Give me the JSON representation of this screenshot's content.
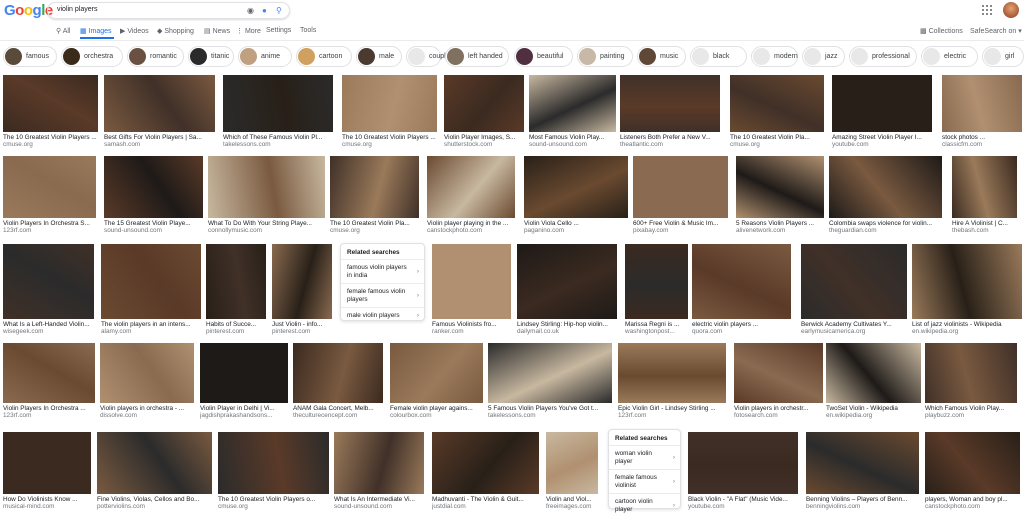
{
  "search": {
    "query": "violin players"
  },
  "logo": {
    "text": "Google",
    "colors": [
      "#4285f4",
      "#ea4335",
      "#fbbc05",
      "#4285f4",
      "#34a853",
      "#ea4335"
    ]
  },
  "tabs": [
    {
      "label": "All",
      "icon": "search-icon"
    },
    {
      "label": "Images",
      "icon": "image-icon",
      "active": true
    },
    {
      "label": "Videos",
      "icon": "video-icon"
    },
    {
      "label": "Shopping",
      "icon": "tag-icon"
    },
    {
      "label": "News",
      "icon": "news-icon"
    },
    {
      "label": "More",
      "icon": "more-icon"
    },
    {
      "label": "Settings"
    },
    {
      "label": "Tools"
    }
  ],
  "right_tools": {
    "collections": "Collections",
    "safesearch": "SafeSearch on"
  },
  "chips": [
    "famous",
    "orchestra",
    "romantic",
    "titanic",
    "anime",
    "cartoon",
    "male",
    "couple",
    "left handed",
    "beautiful",
    "painting",
    "music",
    "black",
    "modern",
    "jazz",
    "professional",
    "electric",
    "girl"
  ],
  "rows": [
    [
      {
        "title": "The 10 Greatest Violin Players ...",
        "source": "cmuse.org"
      },
      {
        "title": "Best Gifts For Violin Players | Sa...",
        "source": "samash.com"
      },
      {
        "title": "Which of These Famous Violin Pl...",
        "source": "takelessons.com"
      },
      {
        "title": "The 10 Greatest Violin Players ...",
        "source": "cmuse.org"
      },
      {
        "title": "Violin Player Images, S...",
        "source": "shutterstock.com"
      },
      {
        "title": "Most Famous Violin Play...",
        "source": "sound-unsound.com"
      },
      {
        "title": "Listeners Both Prefer a New V...",
        "source": "theatlantic.com"
      },
      {
        "title": "The 10 Greatest Violin Pla...",
        "source": "cmuse.org"
      },
      {
        "title": "Amazing Street Violin Player I...",
        "source": "youtube.com"
      },
      {
        "title": "stock photos ...",
        "source": "classicfm.com"
      }
    ],
    [
      {
        "title": "Violin Players In Orchestra S...",
        "source": "123rf.com"
      },
      {
        "title": "The 15 Greatest Violin Playe...",
        "source": "sound-unsound.com"
      },
      {
        "title": "What To Do With Your String Playe...",
        "source": "connollymusic.com"
      },
      {
        "title": "The 10 Greatest Violin Pla...",
        "source": "cmuse.org"
      },
      {
        "title": "Violin player playing in the ...",
        "source": "canstockphoto.com"
      },
      {
        "title": "Violin Viola Cello ...",
        "source": "paganino.com"
      },
      {
        "title": "600+ Free Violin & Music Im...",
        "source": "pixabay.com"
      },
      {
        "title": "5 Reasons Violin Players ...",
        "source": "alivenetwork.com"
      },
      {
        "title": "Colombia swaps violence for violin...",
        "source": "theguardian.com"
      },
      {
        "title": "Hire A Violinist | C...",
        "source": "thebash.com"
      }
    ],
    [
      {
        "title": "What Is a Left-Handed Violin...",
        "source": "wisegeek.com"
      },
      {
        "title": "The violin players in an intens...",
        "source": "alamy.com"
      },
      {
        "title": "Habits of Succe...",
        "source": "pinterest.com"
      },
      {
        "title": "Just Violin - info...",
        "source": "pinterest.com"
      },
      {
        "title": "Famous Violinists fro...",
        "source": "ranker.com"
      },
      {
        "title": "Lindsey Stirling: Hip-hop violin...",
        "source": "dailymail.co.uk"
      },
      {
        "title": "Marissa Regni is ...",
        "source": "washingtonpost..."
      },
      {
        "title": "electric violin players ...",
        "source": "quora.com"
      },
      {
        "title": "Berwick Academy Cultivates Y...",
        "source": "earlymusicamerica.org"
      },
      {
        "title": "List of jazz violinists - Wikipedia",
        "source": "en.wikipedia.org"
      }
    ],
    [
      {
        "title": "Violin Players In Orchestra ...",
        "source": "123rf.com"
      },
      {
        "title": "Violin players in orchestra - ...",
        "source": "dissolve.com"
      },
      {
        "title": "Violin Player in Delhi | Vi...",
        "source": "jagdishprakashandsons..."
      },
      {
        "title": "ANAM Gala Concert, Melb...",
        "source": "theculturecencept.com"
      },
      {
        "title": "Female violin player agains...",
        "source": "colourbox.com"
      },
      {
        "title": "5 Famous Violin Players You've Got t...",
        "source": "takelessons.com"
      },
      {
        "title": "Epic Violin Girl - Lindsey Stirling ...",
        "source": "123rf.com"
      },
      {
        "title": "Violin players in orchestr...",
        "source": "fotosearch.com"
      },
      {
        "title": "TwoSet Violin - Wikipedia",
        "source": "en.wikipedia.org"
      },
      {
        "title": "Which Famous Violin Play...",
        "source": "playbuzz.com"
      }
    ],
    [
      {
        "title": "How Do Violinists Know ...",
        "source": "musical-mind.com"
      },
      {
        "title": "Fine Violins, Violas, Cellos and Bo...",
        "source": "potterviolins.com"
      },
      {
        "title": "The 10 Greatest Violin Players o...",
        "source": "cmuse.org"
      },
      {
        "title": "What Is An Intermediate Vi...",
        "source": "sound-unsound.com"
      },
      {
        "title": "Madhuvanti - The Violin & Guit...",
        "source": "justdial.com"
      },
      {
        "title": "Violin and Viol...",
        "source": "freeimages.com"
      },
      {
        "title": "Black Violin - \"A Flat\" (Music Vide...",
        "source": "youtube.com"
      },
      {
        "title": "Benning Violins – Players of Benn...",
        "source": "benningviolins.com"
      },
      {
        "title": "players, Woman and boy pl...",
        "source": "canstockphoto.com"
      }
    ]
  ],
  "related1": {
    "header": "Related searches",
    "items": [
      "famous violin players in india",
      "female famous violin players",
      "male violin players"
    ]
  },
  "related2": {
    "header": "Related searches",
    "items": [
      "woman violin player",
      "female famous violinist",
      "cartoon violin player"
    ]
  }
}
